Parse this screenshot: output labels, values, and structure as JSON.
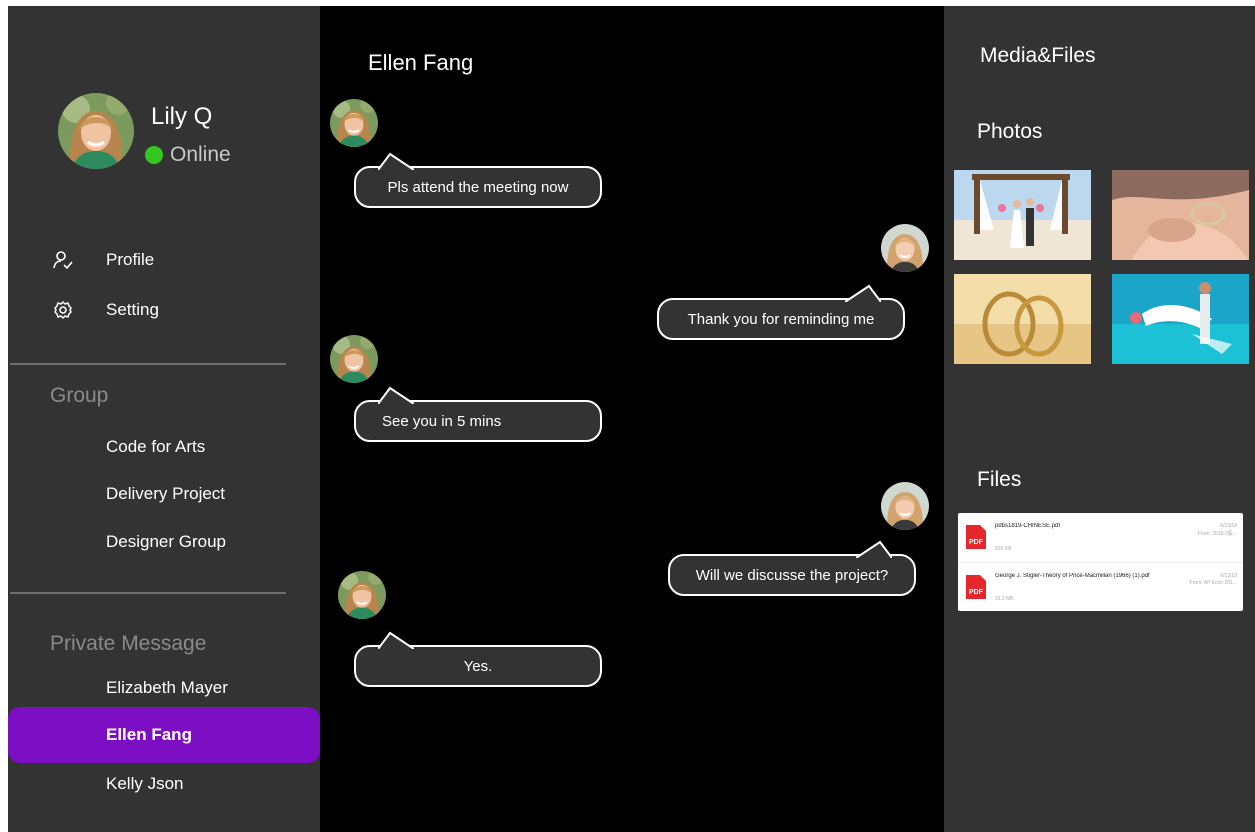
{
  "user": {
    "name": "Lily Q",
    "status": "Online",
    "status_color": "#33c71f"
  },
  "nav": {
    "profile": {
      "label": "Profile",
      "icon": "user-check-icon"
    },
    "setting": {
      "label": "Setting",
      "icon": "gear-icon"
    }
  },
  "groups": {
    "title": "Group",
    "items": [
      "Code for Arts",
      "Delivery Project",
      "Designer Group"
    ]
  },
  "private": {
    "title": "Private Message",
    "items": [
      "Elizabeth Mayer",
      "Ellen Fang",
      "Kelly Json"
    ],
    "active": "Ellen Fang",
    "active_color": "#7c0ec4"
  },
  "chat": {
    "title": "Ellen Fang",
    "messages": [
      {
        "side": "left",
        "text": "Pls attend the meeting now"
      },
      {
        "side": "right",
        "text": "Thank you for reminding me"
      },
      {
        "side": "left",
        "text": "See you in 5 mins"
      },
      {
        "side": "right",
        "text": "Will we discusse the project?"
      },
      {
        "side": "left",
        "text": "Yes."
      }
    ]
  },
  "media": {
    "title": "Media&Files",
    "photos_title": "Photos",
    "files_title": "Files",
    "files": [
      {
        "name": "pdbs1819-CHINESE.pdf",
        "size": "826 KB",
        "date": "6/13/18",
        "from": "From: 2018-2股...",
        "type": "PDF"
      },
      {
        "name": "George J. Stigler-Theory of Price-Macmillan (1966) (1).pdf",
        "size": "16.2 MB",
        "date": "6/13/18",
        "from": "From: AP Econ 201...",
        "type": "PDF"
      }
    ]
  }
}
